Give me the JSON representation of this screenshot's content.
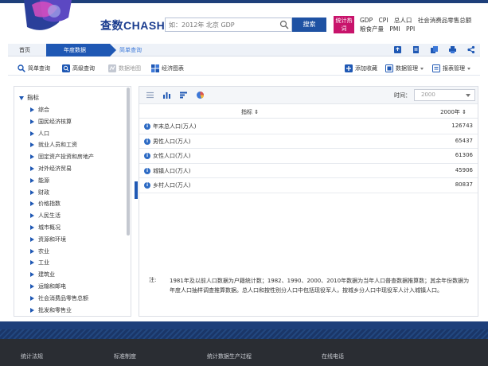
{
  "brand": {
    "name": "查数",
    "en": "CHASHU"
  },
  "search": {
    "placeholder": "如：2012年 北京 GDP",
    "button": "搜索"
  },
  "hot": {
    "tag": "统计热词",
    "links": [
      "GDP",
      "CPI",
      "总人口",
      "社会消费品零售总额",
      "粮食产量",
      "PMI",
      "PPI"
    ]
  },
  "breadcrumb": {
    "home": "首页",
    "active": "年度数据",
    "sub": "简单查询"
  },
  "toolbar": {
    "simple_query": "简单查询",
    "advanced_query": "高级查询",
    "data_map": "数据地图",
    "economic_chart": "经济图表",
    "add_favorite": "添加收藏",
    "data_manage": "数据管理",
    "report_manage": "报表管理"
  },
  "sidebar": {
    "root": "指标",
    "items": [
      "综合",
      "国民经济核算",
      "人口",
      "就业人员和工资",
      "固定资产投资和房地产",
      "对外经济贸易",
      "能源",
      "财政",
      "价格指数",
      "人民生活",
      "城市概况",
      "资源和环境",
      "农业",
      "工业",
      "建筑业",
      "运输和邮电",
      "社会消费品零售总额",
      "批发和零售业"
    ]
  },
  "panel": {
    "time_label": "时间：",
    "time_value": "2000",
    "col_indicator": "指标 ⇕",
    "col_year": "2000年 ⇕"
  },
  "rows": [
    {
      "name": "年末总人口(万人)",
      "value": "126743"
    },
    {
      "name": "男性人口(万人)",
      "value": "65437"
    },
    {
      "name": "女性人口(万人)",
      "value": "61306"
    },
    {
      "name": "城镇人口(万人)",
      "value": "45906"
    },
    {
      "name": "乡村人口(万人)",
      "value": "80837"
    }
  ],
  "note": {
    "label": "注:",
    "text": "1981年及以前人口数据为户籍统计数；1982、1990、2000、2010年数据为当年人口普查数据推算数；其余年份数据为年度人口抽样调查推算数据。总人口和按性别分人口中包括现役军人，按城乡分人口中现役军人计入城镇人口。"
  },
  "footer": {
    "cols": [
      "统计法规",
      "标准制度",
      "统计数据生产过程",
      "在线电话"
    ]
  },
  "colors": {
    "primary": "#1f58b4",
    "hot": "#c8136b",
    "footer": "#2a2d33",
    "band": "#1e3f7a"
  }
}
